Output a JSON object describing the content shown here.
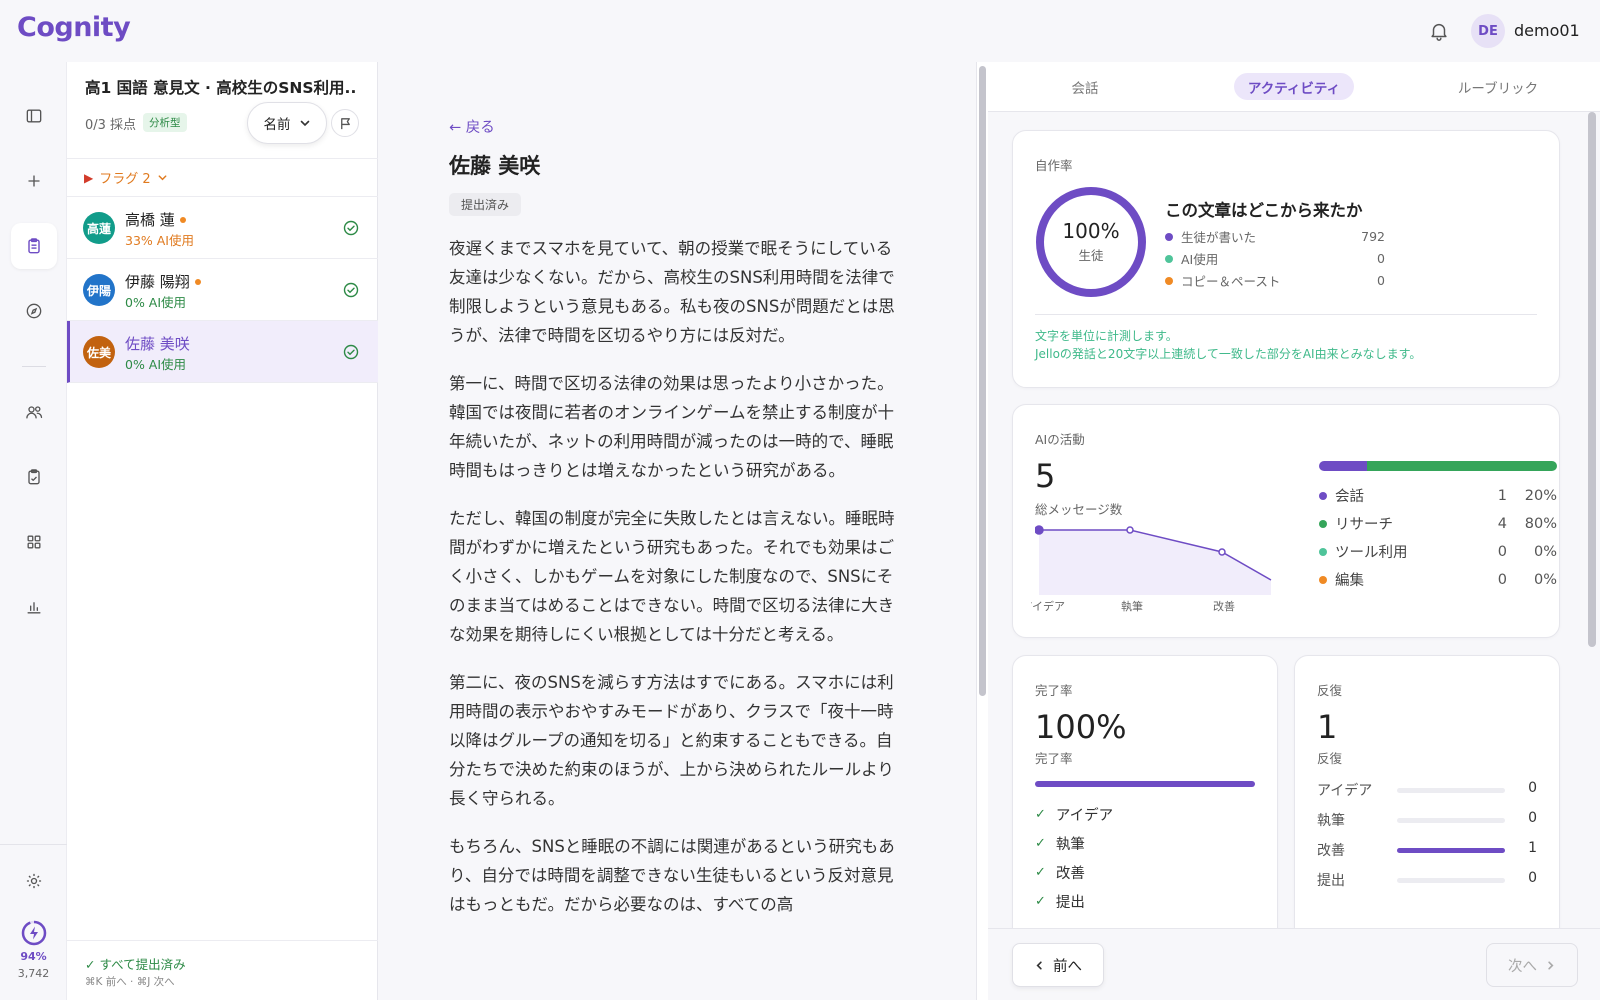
{
  "app": {
    "logo": "Cognity"
  },
  "header": {
    "user_initials": "DE",
    "user_name": "demo01"
  },
  "rail": {
    "credit_percent": "94%",
    "credit_count": "3,742"
  },
  "list": {
    "assignment_title": "高1 国語 意見文 · 高校生のSNS利用...",
    "score_text": "0/3 採点",
    "type_badge": "分析型",
    "sort_label": "名前",
    "flag_label": "フラグ 2",
    "students": [
      {
        "initials": "高蓮",
        "name": "高橋 蓮",
        "ai": "33% AI使用",
        "color": "#119c8a",
        "ai_color": "#e07a1f",
        "dot": true
      },
      {
        "initials": "伊陽",
        "name": "伊藤 陽翔",
        "ai": "0% AI使用",
        "color": "#2274c9",
        "ai_color": "#2d8a46",
        "dot": true
      },
      {
        "initials": "佐美",
        "name": "佐藤 美咲",
        "ai": "0% AI使用",
        "color": "#c2620f",
        "ai_color": "#2d8a46",
        "dot": false
      }
    ],
    "all_submitted": "✓ すべて提出済み",
    "shortcut_hint": "⌘K 前へ · ⌘J 次へ"
  },
  "essay": {
    "back_label": "← 戻る",
    "student_name": "佐藤 美咲",
    "status": "提出済み",
    "paragraphs": [
      "夜遅くまでスマホを見ていて、朝の授業で眠そうにしている友達は少なくない。だから、高校生のSNS利用時間を法律で制限しようという意見もある。私も夜のSNSが問題だとは思うが、法律で時間を区切るやり方には反対だ。",
      "第一に、時間で区切る法律の効果は思ったより小さかった。韓国では夜間に若者のオンラインゲームを禁止する制度が十年続いたが、ネットの利用時間が減ったのは一時的で、睡眠時間もはっきりとは増えなかったという研究がある。",
      "ただし、韓国の制度が完全に失敗したとは言えない。睡眠時間がわずかに増えたという研究もあった。それでも効果はごく小さく、しかもゲームを対象にした制度なので、SNSにそのまま当てはめることはできない。時間で区切る法律に大きな効果を期待しにくい根拠としては十分だと考える。",
      "第二に、夜のSNSを減らす方法はすでにある。スマホには利用時間の表示やおやすみモードがあり、クラスで「夜十一時以降はグループの通知を切る」と約束することもできる。自分たちで決めた約束のほうが、上から決められたルールより長く守られる。",
      "もちろん、SNSと睡眠の不調には関連があるという研究もあり、自分では時間を調整できない生徒もいるという反対意見はもっともだ。だから必要なのは、すべての高"
    ]
  },
  "tabs": {
    "conversation": "会話",
    "activity": "アクティビティ",
    "rubric": "ルーブリック"
  },
  "authorship": {
    "label": "自作率",
    "percent": "100%",
    "percent_value": 100,
    "ring_sub": "生徒",
    "title": "この文章はどこから来たか",
    "rows": [
      {
        "label": "生徒が書いた",
        "value": "792",
        "color": "#6e4cc4"
      },
      {
        "label": "AI使用",
        "value": "0",
        "color": "#4fc49a"
      },
      {
        "label": "コピー＆ペースト",
        "value": "0",
        "color": "#f08a24"
      }
    ],
    "note1": "文字を単位に計測します。",
    "note2": "Jelloの発話と20文字以上連続して一致した部分をAI由来とみなします。"
  },
  "ai_activity": {
    "label": "AIの活動",
    "total": "5",
    "total_label": "総メッセージ数",
    "rows": [
      {
        "label": "会話",
        "count": "1",
        "pct": "20%",
        "pct_value": 20,
        "color": "#6e4cc4"
      },
      {
        "label": "リサーチ",
        "count": "4",
        "pct": "80%",
        "pct_value": 80,
        "color": "#35a55a"
      },
      {
        "label": "ツール利用",
        "count": "0",
        "pct": "0%",
        "pct_value": 0,
        "color": "#4fc49a"
      },
      {
        "label": "編集",
        "count": "0",
        "pct": "0%",
        "pct_value": 0,
        "color": "#f08a24"
      }
    ],
    "spark_labels": [
      "アイデア",
      "執筆",
      "改善"
    ],
    "spark_values": [
      1,
      1,
      0.45,
      0
    ]
  },
  "completion": {
    "label": "完了率",
    "value": "100%",
    "value_label": "完了率",
    "percent_value": 100,
    "steps": [
      "アイデア",
      "執筆",
      "改善",
      "提出"
    ]
  },
  "iteration": {
    "label": "反復",
    "value": "1",
    "value_label": "反復",
    "rows": [
      {
        "label": "アイデア",
        "value": "0",
        "fill": 0
      },
      {
        "label": "執筆",
        "value": "0",
        "fill": 0
      },
      {
        "label": "改善",
        "value": "1",
        "fill": 1
      },
      {
        "label": "提出",
        "value": "0",
        "fill": 0
      }
    ]
  },
  "nav": {
    "prev": "前へ",
    "next": "次へ"
  }
}
